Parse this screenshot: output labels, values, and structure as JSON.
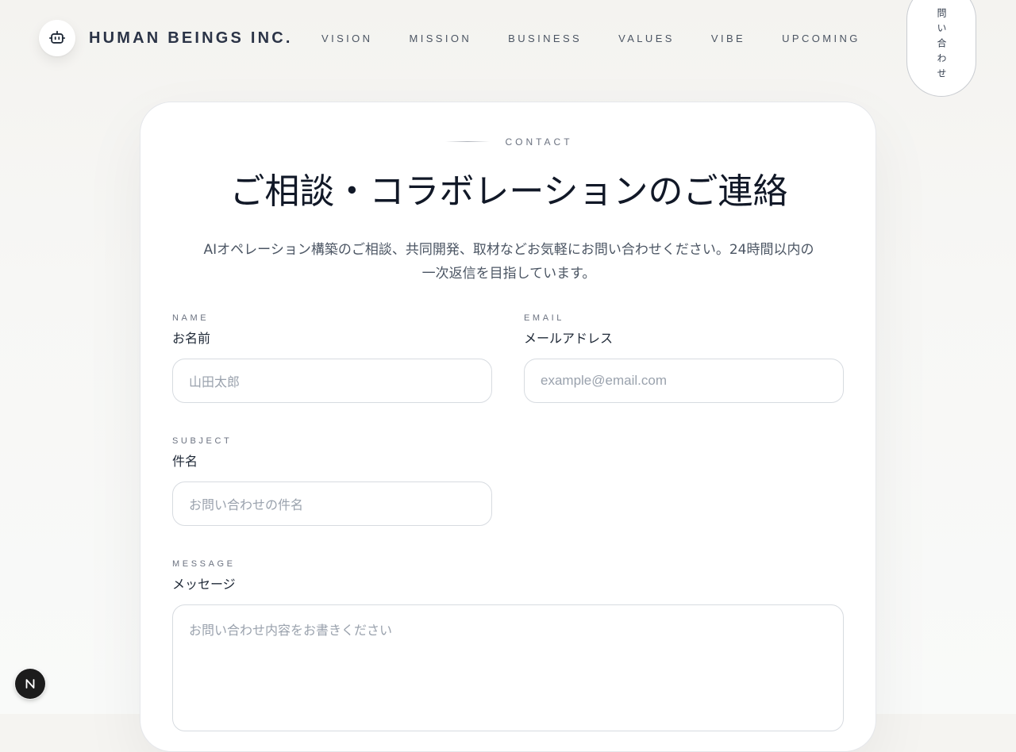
{
  "header": {
    "logo_icon": "robot-icon",
    "brand": "HUMAN BEINGS INC.",
    "nav": [
      {
        "label": "VISION"
      },
      {
        "label": "MISSION"
      },
      {
        "label": "BUSINESS"
      },
      {
        "label": "VALUES"
      },
      {
        "label": "VIBE"
      },
      {
        "label": "UPCOMING"
      }
    ],
    "contact_button": "問い合わせ"
  },
  "contact": {
    "eyebrow": "CONTACT",
    "title": "ご相談・コラボレーションのご連絡",
    "lead": "AIオペレーション構築のご相談、共同開発、取材などお気軽にお問い合わせください。24時間以内の一次返信を目指しています。",
    "fields": {
      "name": {
        "caps": "NAME",
        "label": "お名前",
        "placeholder": "山田太郎"
      },
      "email": {
        "caps": "EMAIL",
        "label": "メールアドレス",
        "placeholder": "example@email.com"
      },
      "subject": {
        "caps": "SUBJECT",
        "label": "件名",
        "placeholder": "お問い合わせの件名"
      },
      "message": {
        "caps": "MESSAGE",
        "label": "メッセージ",
        "placeholder": "お問い合わせ内容をお書きください"
      }
    }
  },
  "badge": {
    "letter": "N",
    "icon": "nextjs-n-icon"
  },
  "colors": {
    "background": "#f5f4f1",
    "card": "#ffffff",
    "text_dark": "#111827",
    "text_muted": "#6b7280",
    "border": "#d7dbe0",
    "badge": "#1c1c1c"
  }
}
